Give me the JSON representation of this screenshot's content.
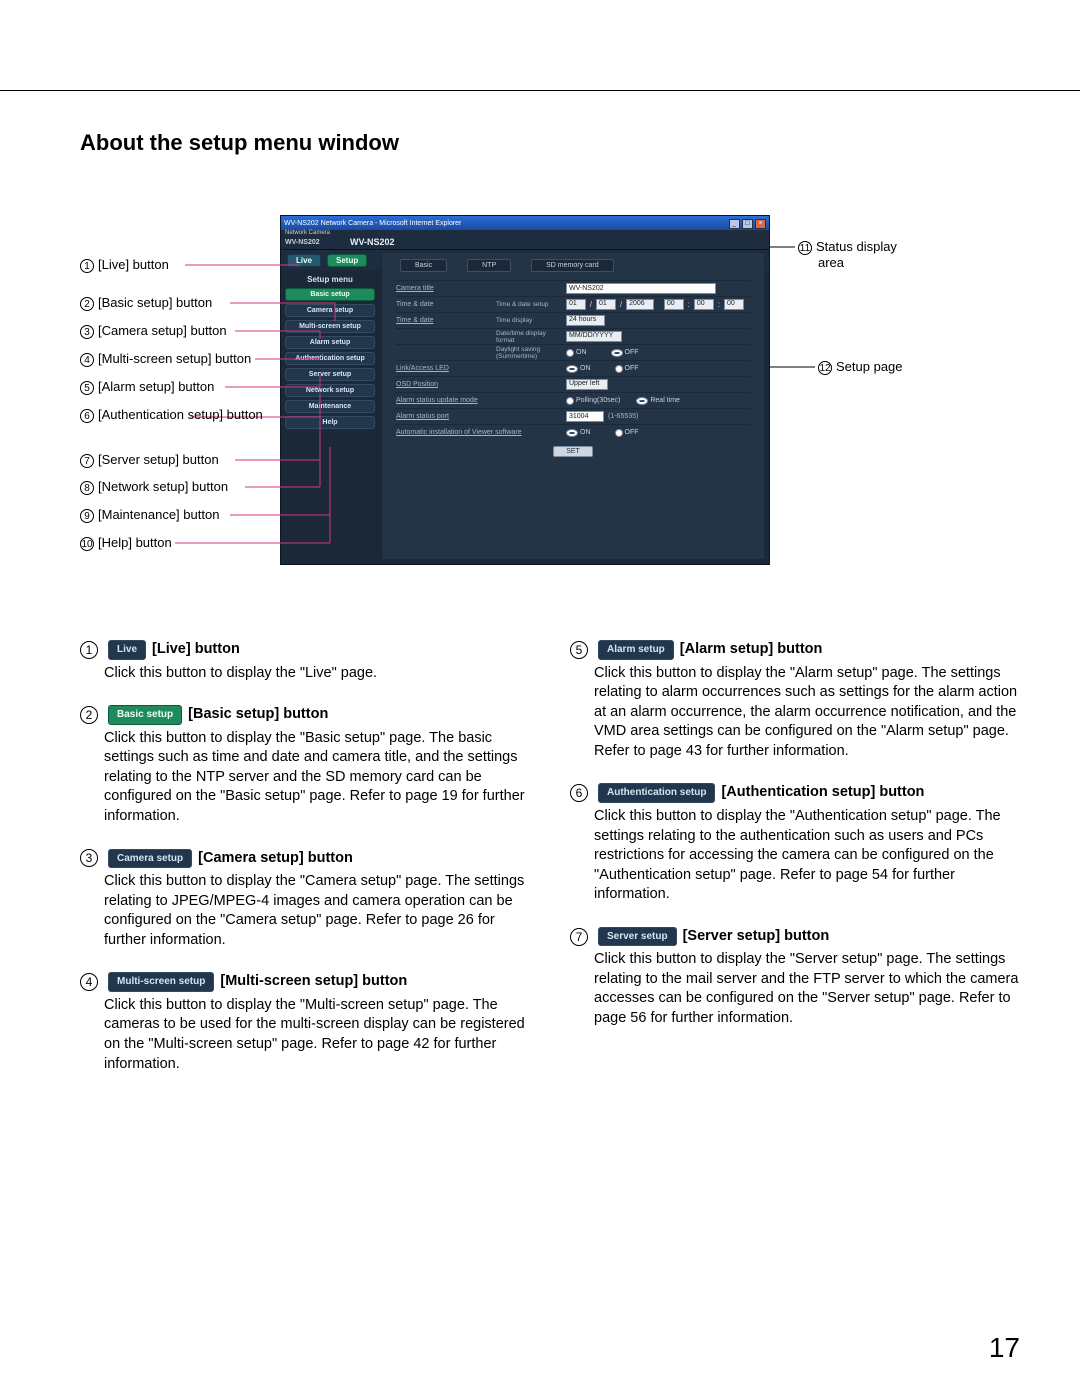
{
  "pageTitle": "About the setup menu window",
  "pageNumber": "17",
  "window": {
    "title": "WV-NS202 Network Camera - Microsoft Internet Explorer",
    "headerSmall": "Network Camera",
    "headerModel": "WV-NS202",
    "statusModel": "WV-NS202",
    "liveBtn": "Live",
    "setupBtn": "Setup",
    "menuTitle": "Setup menu",
    "menu": [
      "Basic setup",
      "Camera setup",
      "Multi-screen setup",
      "Alarm setup",
      "Authentication setup",
      "Server setup",
      "Network setup",
      "Maintenance",
      "Help"
    ],
    "tabs": [
      "Basic",
      "NTP",
      "SD memory card"
    ],
    "rows": {
      "cameraTitle": {
        "label": "Camera title",
        "value": "WV-NS202"
      },
      "timeDate": {
        "label": "Time & date",
        "sub": "Time & date setup",
        "month": "01",
        "day": "01",
        "year": "2006",
        "h": "00",
        "m": "00",
        "s": "00"
      },
      "timeDisplay": {
        "sub": "Time display",
        "value": "24 hours"
      },
      "dtFormat": {
        "sub": "Date/time display format",
        "value": "MM/DD/YYYY"
      },
      "daylight": {
        "sub": "Daylight saving (Summertime)",
        "on": "ON",
        "off": "OFF"
      },
      "linkLED": {
        "label": "Link/Access LED",
        "on": "ON",
        "off": "OFF"
      },
      "osd": {
        "label": "OSD Position",
        "value": "Upper left"
      },
      "alarmMode": {
        "label": "Alarm status update mode",
        "poll": "Polling(30sec)",
        "real": "Real time"
      },
      "alarmPort": {
        "label": "Alarm status port",
        "value": "31004",
        "hint": "(1-65535)"
      },
      "autoInstall": {
        "label": "Automatic installation of Viewer software",
        "on": "ON",
        "off": "OFF"
      },
      "setBtn": "SET"
    }
  },
  "callouts": {
    "l1": "[Live] button",
    "l2": "[Basic setup] button",
    "l3": "[Camera setup] button",
    "l4": "[Multi-screen setup] button",
    "l5": "[Alarm setup] button",
    "l6": "[Authentication setup] button",
    "l7": "[Server setup] button",
    "l8": "[Network setup] button",
    "l9": "[Maintenance] button",
    "l10": "[Help] button",
    "r11a": "Status display",
    "r11b": "area",
    "r12": "Setup page"
  },
  "descriptions": [
    {
      "n": "1",
      "pill": "Live",
      "pillClass": "",
      "title": "[Live] button",
      "body": "Click this button to display the \"Live\" page."
    },
    {
      "n": "2",
      "pill": "Basic setup",
      "pillClass": "green",
      "title": "[Basic setup] button",
      "body": "Click this button to display the \"Basic setup\" page. The basic settings such as time and date and camera title, and the settings relating to the NTP server and the SD memory card can be configured on the \"Basic setup\" page. Refer to page 19 for further information."
    },
    {
      "n": "3",
      "pill": "Camera setup",
      "pillClass": "",
      "title": "[Camera setup] button",
      "body": "Click this button to display the \"Camera setup\" page. The settings relating to JPEG/MPEG-4 images and camera operation can be configured on the \"Camera setup\" page. Refer to page 26 for further information."
    },
    {
      "n": "4",
      "pill": "Multi-screen setup",
      "pillClass": "",
      "title": "[Multi-screen setup] button",
      "body": "Click this button to display the \"Multi-screen setup\" page. The cameras to be used for the multi-screen display can be registered on the \"Multi-screen setup\" page. Refer to page 42 for further information."
    },
    {
      "n": "5",
      "pill": "Alarm setup",
      "pillClass": "",
      "title": "[Alarm setup] button",
      "body": "Click this button to display the \"Alarm setup\" page. The settings relating to alarm occurrences such as settings for the alarm action at an alarm occurrence, the alarm occurrence notification, and the VMD area settings can be configured on the \"Alarm setup\" page. Refer to page 43 for further information."
    },
    {
      "n": "6",
      "pill": "Authentication setup",
      "pillClass": "",
      "title": "[Authentication setup] button",
      "body": "Click this button to display the \"Authentication setup\" page. The settings relating to the authentication such as users and PCs restrictions for accessing the camera can be configured on the \"Authentication setup\" page. Refer to page 54 for further information."
    },
    {
      "n": "7",
      "pill": "Server setup",
      "pillClass": "",
      "title": "[Server setup] button",
      "body": "Click this button to display the \"Server setup\" page. The settings relating to the mail server and the FTP server to which the camera accesses can be configured on the \"Server setup\" page. Refer to page 56 for further information."
    }
  ]
}
